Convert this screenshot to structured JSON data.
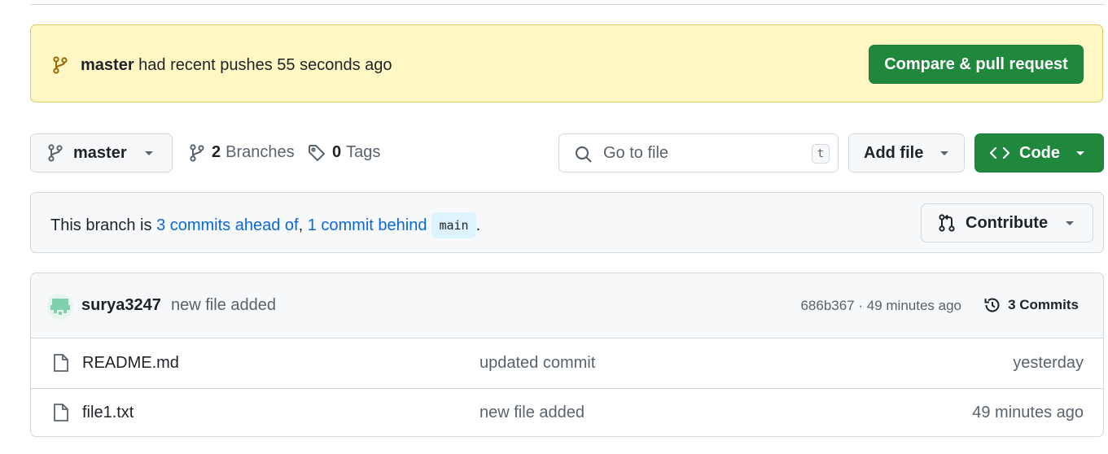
{
  "banner": {
    "branch": "master",
    "message": " had recent pushes 55 seconds ago",
    "compare_label": "Compare & pull request"
  },
  "controls": {
    "branch_label": "master",
    "branches_count": "2",
    "branches_label": "Branches",
    "tags_count": "0",
    "tags_label": "Tags",
    "search_placeholder": "Go to file",
    "search_shortcut": "t",
    "add_file_label": "Add file",
    "code_label": "Code"
  },
  "branch_info": {
    "prefix": "This branch is ",
    "ahead": "3 commits ahead of",
    "comma": ", ",
    "behind": "1 commit behind",
    "base": "main",
    "suffix": ".",
    "contribute_label": "Contribute"
  },
  "latest_commit": {
    "author": "surya3247",
    "message": "new file added",
    "hash_time": "686b367 · 49 minutes ago",
    "commits_label": "3 Commits"
  },
  "files": [
    {
      "name": "README.md",
      "message": "updated commit",
      "date": "yesterday"
    },
    {
      "name": "file1.txt",
      "message": "new file added",
      "date": "49 minutes ago"
    }
  ],
  "colors": {
    "primary_green": "#1f883d",
    "link_blue": "#0969da",
    "banner_bg": "#fff8c5"
  }
}
